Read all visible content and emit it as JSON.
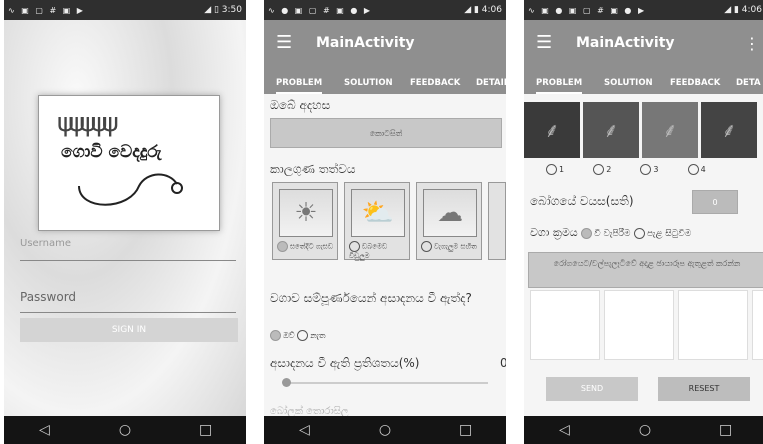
{
  "phone1": {
    "status_icons": "∿ ▣ ▢ # ▣ ▶",
    "status_right": "◢ ▯ 3:50",
    "logo_wheat": "ψψψψψ",
    "logo_title": "ගොවි වෙදදුරු",
    "username_placeholder": "Username",
    "password_placeholder": "Password",
    "signin_label": "SIGN IN"
  },
  "phone2": {
    "status_icons": "∿ ● ▣ ▢ # ▣ ● ▶",
    "status_right": "◢ ▮ 4:06",
    "title": "MainActivity",
    "tabs": [
      "PROBLEM",
      "SOLUTION",
      "FEEDBACK",
      "DETAIL"
    ],
    "idea_label": "ඔබේ අදහස",
    "record_button": "කොටසිත්",
    "weather_label": "කාලගුණ තත්වය",
    "weather_options": [
      "සතේදිට ගැසඩ",
      "ඩබමෙඩ විඩුලුම",
      "වැගැලුම සහිත"
    ],
    "q_label": "වගාව සම්පූර්ණයෙන් අසාදනය වී ඇත්ද?",
    "yes": "ඔව්",
    "no": "නැත",
    "percent_label": "අසාදනය වී ඇති ප්‍රතිශතය(%)",
    "percent_value": "0",
    "cut_label": "බෝලක් තොරාසිල"
  },
  "phone3": {
    "status_icons": "∿ ▣ ● ▣ ▢ # ▣ ● ▶",
    "status_right": "◢ ▮ 4:06",
    "title": "MainActivity",
    "tabs": [
      "PROBLEM",
      "SOLUTION",
      "FEEDBACK",
      "DETA"
    ],
    "radio_labels": [
      "1",
      "2",
      "3",
      "4"
    ],
    "age_label": "බෝගයේ වයස(සති)",
    "age_value": "0",
    "method_label": "වගා ක්‍රමය",
    "method_opt1": "වී වැපිරීම",
    "method_opt2": "පැළ සිටුවීම",
    "upload_button": "රෝගයෙට/වල්පැලෑටිවේ අදාළ ඡායාරූප ඇතුළත් කරන්න",
    "send_label": "SEND",
    "reset_label": "RESEST"
  },
  "nav": {
    "back": "◁",
    "home": "○",
    "recent": "□"
  }
}
